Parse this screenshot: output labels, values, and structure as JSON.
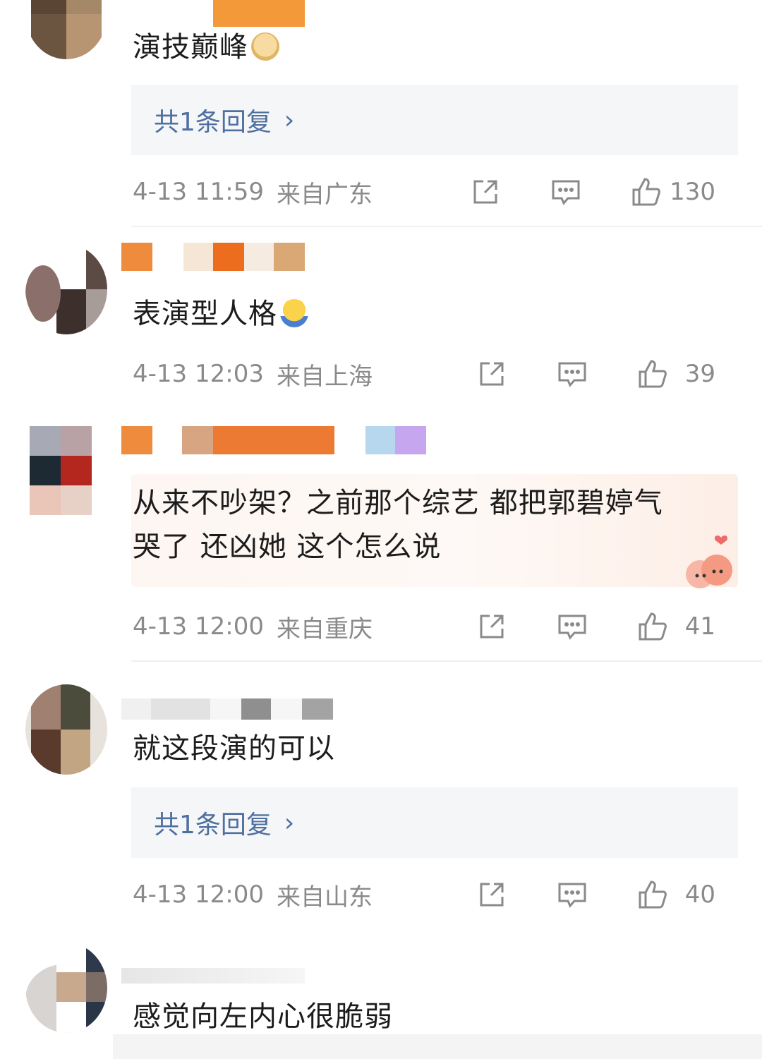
{
  "comments": [
    {
      "text": "演技巅峰",
      "reply_label": "共1条回复",
      "time": "4-13 11:59",
      "location": "来自广东",
      "likes": "130"
    },
    {
      "text": "表演型人格",
      "time": "4-13 12:03",
      "location": "来自上海",
      "likes": "39"
    },
    {
      "text_line1": "从来不吵架？之前那个综艺 都把郭碧婷气",
      "text_line2": "哭了 还凶她 这个怎么说",
      "time": "4-13 12:00",
      "location": "来自重庆",
      "likes": "41"
    },
    {
      "text": "就这段演的可以",
      "reply_label": "共1条回复",
      "time": "4-13 12:00",
      "location": "来自山东",
      "likes": "40"
    },
    {
      "text": "感觉向左内心很脆弱"
    }
  ],
  "icons": {
    "share": "share-icon",
    "comment": "comment-icon",
    "like": "thumbs-up-icon",
    "chevron": "chevron-right-icon"
  },
  "chevron_glyph": "›",
  "colors": {
    "reply_link": "#4e6fa0",
    "meta_text": "#8a8a8a",
    "reply_bg": "#f5f6f8"
  }
}
